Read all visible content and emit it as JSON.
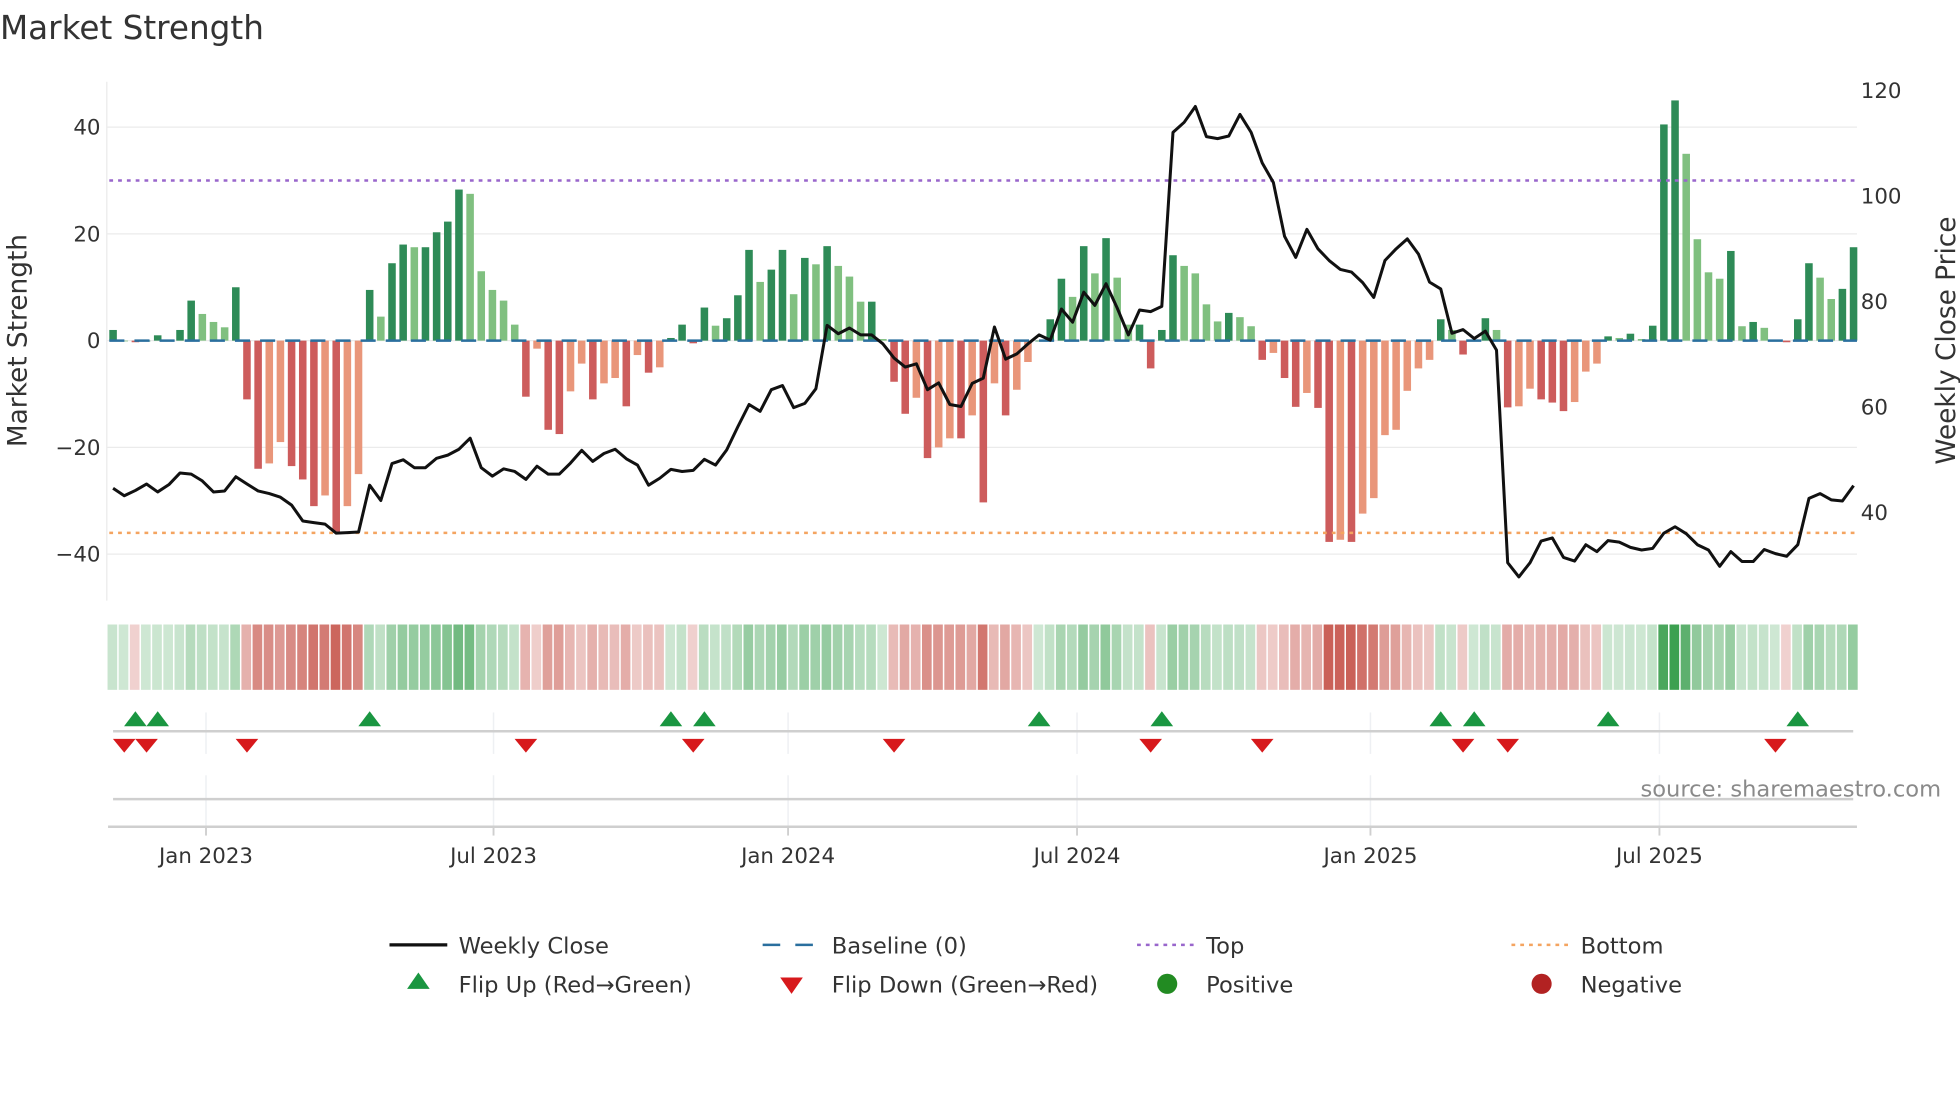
{
  "chart_data": {
    "type": "bar",
    "title": "Market Strength",
    "ylabel": "Market Strength",
    "y2label": "Weekly Close Price",
    "ylim": [
      -48.7,
      48.5
    ],
    "y2lim": [
      23.3,
      121.7
    ],
    "yticks": [
      40,
      20,
      0,
      -20,
      -40
    ],
    "ytick_labels": [
      "40",
      "20",
      "0",
      "−20",
      "−40"
    ],
    "y2ticks": [
      120,
      100,
      80,
      60,
      40
    ],
    "y2tick_labels": [
      "120",
      "100",
      "80",
      "60",
      "40"
    ],
    "xticks": [
      {
        "label": "Jan 2023",
        "week": 8.33
      },
      {
        "label": "Jul 2023",
        "week": 34.1
      },
      {
        "label": "Jan 2024",
        "week": 60.5
      },
      {
        "label": "Jul 2024",
        "week": 86.4
      },
      {
        "label": "Jan 2025",
        "week": 112.7
      },
      {
        "label": "Jul 2025",
        "week": 138.6
      }
    ],
    "top_level": 30,
    "bottom_level": -36,
    "baseline": 0,
    "strength": [
      2,
      0,
      -0.3,
      0,
      1,
      0.2,
      2,
      7.5,
      5,
      3.5,
      2.5,
      10,
      -11,
      -24,
      -23,
      -19,
      -23.5,
      -26,
      -31,
      -29,
      -36,
      -31,
      -25,
      9.5,
      4.5,
      14.5,
      18,
      17.5,
      17.5,
      20.3,
      22.3,
      28.3,
      27.5,
      13,
      9.5,
      7.5,
      3,
      -10.5,
      -1.5,
      -16.7,
      -17.5,
      -9.5,
      -4.3,
      -11,
      -8,
      -7,
      -12.3,
      -2.7,
      -6,
      -5,
      0.5,
      3,
      -0.5,
      6.2,
      2.8,
      4.2,
      8.5,
      17,
      11,
      13.3,
      17,
      8.7,
      15.5,
      14.3,
      17.7,
      14,
      12,
      7.3,
      7.3,
      0.3,
      -7.7,
      -13.7,
      -10.7,
      -22,
      -20,
      -18.3,
      -18.3,
      -14,
      -30.3,
      -8,
      -14,
      -9.2,
      -4,
      0,
      4,
      11.6,
      8.2,
      17.7,
      12.6,
      19.2,
      11.8,
      3,
      3,
      -5.2,
      2,
      16,
      14,
      12.6,
      6.8,
      3.6,
      5.2,
      4.4,
      2.7,
      -3.6,
      -2.3,
      -7,
      -12.4,
      -9.8,
      -12.6,
      -37.7,
      -37.3,
      -37.7,
      -32.4,
      -29.5,
      -17.7,
      -16.7,
      -9.4,
      -5.2,
      -3.6,
      4,
      2,
      -2.6,
      0,
      4.2,
      2,
      -12.5,
      -12.3,
      -9,
      -11,
      -11.6,
      -13.2,
      -11.5,
      -5.8,
      -4.3,
      0.8,
      0.5,
      1.3,
      0.3,
      2.8,
      40.5,
      45,
      35,
      19,
      12.8,
      11.6,
      16.8,
      2.7,
      3.5,
      2.4,
      0,
      -0.3,
      4,
      14.5,
      11.8,
      7.8,
      9.7,
      17.5
    ],
    "weekly_close": [
      44.6,
      43.2,
      44.2,
      45.4,
      43.9,
      45.3,
      47.5,
      47.3,
      46.0,
      43.9,
      44.1,
      46.8,
      45.4,
      44.1,
      43.6,
      42.9,
      41.4,
      38.4,
      38.1,
      37.8,
      36.1,
      36.2,
      36.3,
      45.2,
      42.3,
      49.3,
      50.0,
      48.5,
      48.5,
      50.3,
      50.9,
      52.0,
      54.1,
      48.5,
      46.9,
      48.3,
      47.8,
      46.3,
      48.8,
      47.3,
      47.3,
      49.4,
      51.8,
      49.7,
      51.2,
      52.0,
      50.2,
      49.0,
      45.2,
      46.5,
      48.2,
      47.8,
      48.0,
      50.1,
      49.0,
      51.9,
      56.3,
      60.5,
      59.2,
      63.3,
      64.1,
      59.9,
      60.7,
      63.5,
      75.5,
      73.9,
      75.0,
      73.7,
      73.7,
      72.0,
      69.3,
      67.6,
      68.2,
      63.3,
      64.6,
      60.5,
      60.1,
      64.5,
      65.5,
      75.2,
      69.1,
      70.1,
      72.0,
      73.7,
      72.7,
      78.6,
      76.1,
      81.8,
      79.3,
      83.4,
      78.8,
      73.7,
      78.4,
      78.1,
      79.1,
      112.1,
      114.0,
      117.0,
      111.3,
      110.9,
      111.4,
      115.5,
      112.1,
      106.3,
      102.6,
      92.4,
      88.4,
      93.7,
      90.0,
      87.8,
      86.1,
      85.6,
      83.6,
      80.8,
      87.8,
      90.0,
      91.9,
      89.0,
      83.7,
      82.4,
      74.0,
      74.7,
      73.0,
      74.4,
      70.8,
      30.5,
      27.8,
      30.5,
      34.6,
      35.2,
      31.5,
      30.8,
      33.9,
      32.6,
      34.7,
      34.4,
      33.4,
      32.9,
      33.2,
      36.1,
      37.3,
      36.0,
      33.9,
      32.9,
      29.8,
      32.6,
      30.7,
      30.7,
      33.0,
      32.2,
      31.7,
      33.9,
      42.7,
      43.6,
      42.4,
      42.2,
      45.1
    ],
    "flip_up_weeks": [
      2,
      4,
      23,
      50,
      53,
      83,
      94,
      119,
      122,
      134,
      151
    ],
    "flip_down_weeks": [
      1,
      3,
      12,
      37,
      52,
      70,
      93,
      103,
      121,
      125,
      149
    ],
    "legend": {
      "placement": "bottom",
      "items": [
        {
          "label": "Weekly Close",
          "kind": "line-solid"
        },
        {
          "label": "Baseline (0)",
          "kind": "line-dashed"
        },
        {
          "label": "Top",
          "kind": "line-dotted-top"
        },
        {
          "label": "Bottom",
          "kind": "line-dotted-bottom"
        },
        {
          "label": "Flip Up (Red→Green)",
          "kind": "triangle-up"
        },
        {
          "label": "Flip Down (Green→Red)",
          "kind": "triangle-down"
        },
        {
          "label": "Positive",
          "kind": "dot-positive"
        },
        {
          "label": "Negative",
          "kind": "dot-negative"
        }
      ]
    },
    "source": "source: sharemaestro.com"
  },
  "colors": {
    "pos_strong": "#2e8b57",
    "pos_weak": "#80c080",
    "neg_strong": "#cd5c5c",
    "neg_weak": "#e9967a",
    "price": "#111111",
    "baseline": "#2a6f9e",
    "top": "#9966cc",
    "bottom": "#f4a460",
    "flip_up": "#1a9641",
    "flip_down": "#d7191c",
    "positive_dot": "#228b22",
    "negative_dot": "#b22222"
  }
}
